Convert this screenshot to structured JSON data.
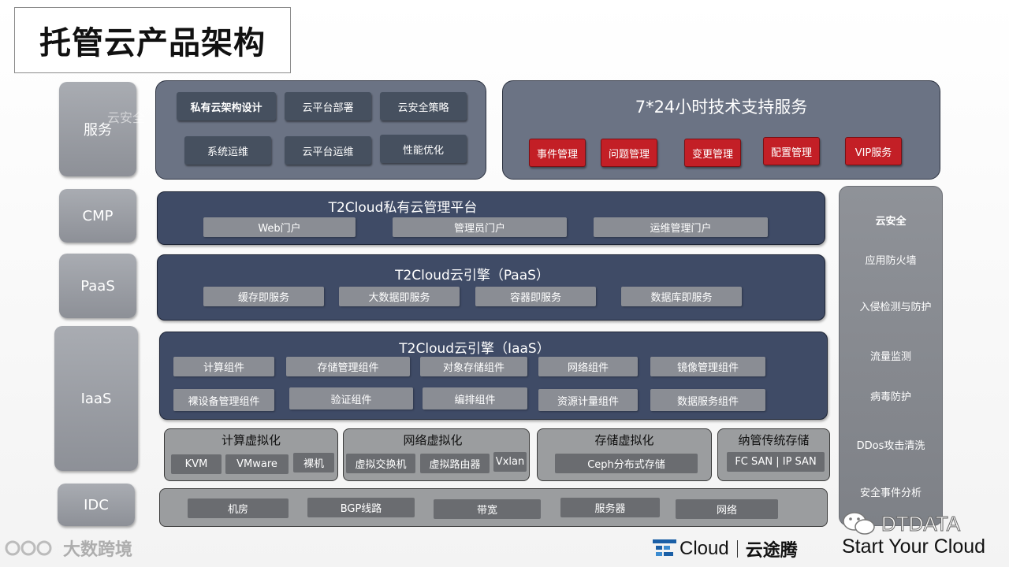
{
  "title": "托管云产品架构",
  "layers": {
    "service": "服务",
    "cmp": "CMP",
    "paas": "PaaS",
    "iaas": "IaaS",
    "idc": "IDC"
  },
  "faint_text": "云安全",
  "consulting": {
    "items": [
      "私有云架构设计",
      "云平台部署",
      "云安全策略",
      "系统运维",
      "云平台运维",
      "性能优化"
    ]
  },
  "support": {
    "title": "7*24小时技术支持服务",
    "items": [
      "事件管理",
      "问题管理",
      "变更管理",
      "配置管理",
      "VIP服务"
    ]
  },
  "cmp_panel": {
    "title": "T2Cloud私有云管理平台",
    "items": [
      "Web门户",
      "管理员门户",
      "运维管理门户"
    ]
  },
  "paas_panel": {
    "title": "T2Cloud云引擎（PaaS）",
    "items": [
      "缓存即服务",
      "大数据即服务",
      "容器即服务",
      "数据库即服务"
    ]
  },
  "iaas_panel": {
    "title": "T2Cloud云引擎（IaaS）",
    "items": [
      "计算组件",
      "存储管理组件",
      "对象存储组件",
      "网络组件",
      "镜像管理组件",
      "裸设备管理组件",
      "验证组件",
      "编排组件",
      "资源计量组件",
      "数据服务组件"
    ]
  },
  "virtualization": {
    "compute": {
      "title": "计算虚拟化",
      "items": [
        "KVM",
        "VMware",
        "裸机"
      ]
    },
    "network": {
      "title": "网络虚拟化",
      "items": [
        "虚拟交换机",
        "虚拟路由器",
        "Vxlan"
      ]
    },
    "storage": {
      "title": "存储虚拟化",
      "items": [
        "Ceph分布式存储"
      ]
    },
    "legacy": {
      "title": "纳管传统存储",
      "items": [
        "FC SAN | IP SAN"
      ]
    }
  },
  "idc_panel": {
    "items": [
      "机房",
      "BGP线路",
      "带宽",
      "服务器",
      "网络"
    ]
  },
  "security": {
    "title": "云安全",
    "items": [
      "应用防火墙",
      "入侵检测与防护",
      "流量监测",
      "病毒防护",
      "DDos攻击清洗",
      "安全事件分析"
    ]
  },
  "footer": {
    "watermark_left": "大数跨境",
    "watermark_right": "DTDATA",
    "brand_cloud": "Cloud",
    "brand_cn": "云途腾",
    "slogan": "Start Your Cloud"
  },
  "colors": {
    "red": "#c31f26",
    "dark_panel": "#3f4b66",
    "light_panel": "#6b7384"
  }
}
